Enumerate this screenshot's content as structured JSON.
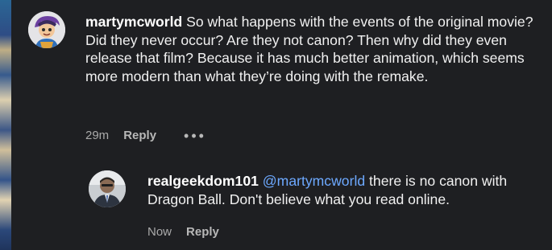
{
  "comments": [
    {
      "username": "martymcworld",
      "text": " So what happens with the events of the original movie? Did they never occur? Are they not canon? Then why did they even release that film? Because it has much better animation, which seems more modern than what they’re doing with the remake.",
      "time": "29m",
      "reply_label": "Reply",
      "more_label": "•••"
    },
    {
      "username": "realgeekdom101",
      "mention": "@martymcworld",
      "text": " there is no canon with Dragon Ball. Don't believe what you read online.",
      "time": "Now",
      "reply_label": "Reply"
    }
  ],
  "colors": {
    "background": "#1e1f22",
    "mention": "#6da9ff",
    "meta": "#aaaaaa"
  }
}
